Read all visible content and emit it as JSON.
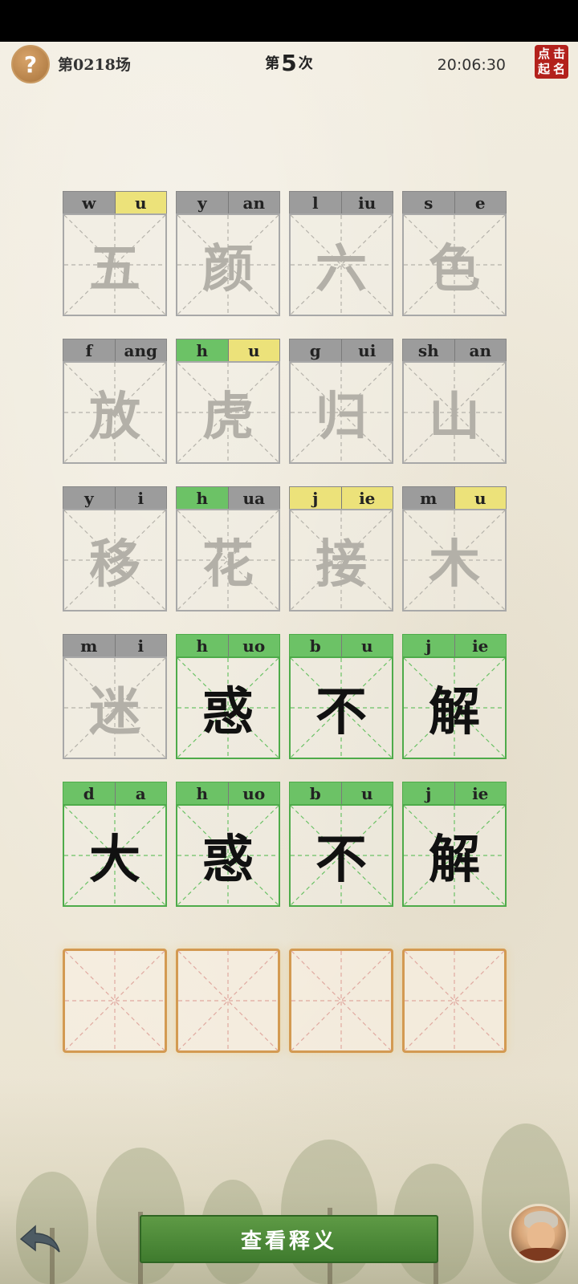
{
  "header": {
    "help_icon": "question-mark-icon",
    "help_label": "?",
    "session_label": "第0218场",
    "attempt_prefix": "第",
    "attempt_number": "5",
    "attempt_suffix": "次",
    "clock": "20:06:30",
    "seal_chars": [
      "点",
      "击",
      "起",
      "名"
    ]
  },
  "board": {
    "rows": [
      [
        {
          "initial": "w",
          "final": "u",
          "initial_state": "gray",
          "final_state": "yellow",
          "char": "五",
          "solved": false
        },
        {
          "initial": "y",
          "final": "an",
          "initial_state": "gray",
          "final_state": "gray",
          "char": "颜",
          "solved": false
        },
        {
          "initial": "l",
          "final": "iu",
          "initial_state": "gray",
          "final_state": "gray",
          "char": "六",
          "solved": false
        },
        {
          "initial": "s",
          "final": "e",
          "initial_state": "gray",
          "final_state": "gray",
          "char": "色",
          "solved": false
        }
      ],
      [
        {
          "initial": "f",
          "final": "ang",
          "initial_state": "gray",
          "final_state": "gray",
          "char": "放",
          "solved": false
        },
        {
          "initial": "h",
          "final": "u",
          "initial_state": "green",
          "final_state": "yellow",
          "char": "虎",
          "solved": false
        },
        {
          "initial": "g",
          "final": "ui",
          "initial_state": "gray",
          "final_state": "gray",
          "char": "归",
          "solved": false
        },
        {
          "initial": "sh",
          "final": "an",
          "initial_state": "gray",
          "final_state": "gray",
          "char": "山",
          "solved": false
        }
      ],
      [
        {
          "initial": "y",
          "final": "i",
          "initial_state": "gray",
          "final_state": "gray",
          "char": "移",
          "solved": false
        },
        {
          "initial": "h",
          "final": "ua",
          "initial_state": "green",
          "final_state": "gray",
          "char": "花",
          "solved": false
        },
        {
          "initial": "j",
          "final": "ie",
          "initial_state": "yellow",
          "final_state": "yellow",
          "char": "接",
          "solved": false
        },
        {
          "initial": "m",
          "final": "u",
          "initial_state": "gray",
          "final_state": "yellow",
          "char": "木",
          "solved": false
        }
      ],
      [
        {
          "initial": "m",
          "final": "i",
          "initial_state": "gray",
          "final_state": "gray",
          "char": "迷",
          "solved": false
        },
        {
          "initial": "h",
          "final": "uo",
          "initial_state": "green",
          "final_state": "green",
          "char": "惑",
          "solved": true
        },
        {
          "initial": "b",
          "final": "u",
          "initial_state": "green",
          "final_state": "green",
          "char": "不",
          "solved": true
        },
        {
          "initial": "j",
          "final": "ie",
          "initial_state": "green",
          "final_state": "green",
          "char": "解",
          "solved": true
        }
      ],
      [
        {
          "initial": "d",
          "final": "a",
          "initial_state": "green",
          "final_state": "green",
          "char": "大",
          "solved": true
        },
        {
          "initial": "h",
          "final": "uo",
          "initial_state": "green",
          "final_state": "green",
          "char": "惑",
          "solved": true
        },
        {
          "initial": "b",
          "final": "u",
          "initial_state": "green",
          "final_state": "green",
          "char": "不",
          "solved": true
        },
        {
          "initial": "j",
          "final": "ie",
          "initial_state": "green",
          "final_state": "green",
          "char": "解",
          "solved": true
        }
      ]
    ],
    "input_slots": 4
  },
  "footer": {
    "view_meaning_label": "查看释义",
    "back_icon": "back-arrow-icon",
    "avatar_icon": "sage-avatar-icon"
  },
  "colors": {
    "green": "#6cc266",
    "yellow": "#ece27a",
    "gray": "#9c9c9c",
    "slot_border": "#d39a52",
    "button_green": "#4e8b39",
    "seal_red": "#b3211c"
  }
}
